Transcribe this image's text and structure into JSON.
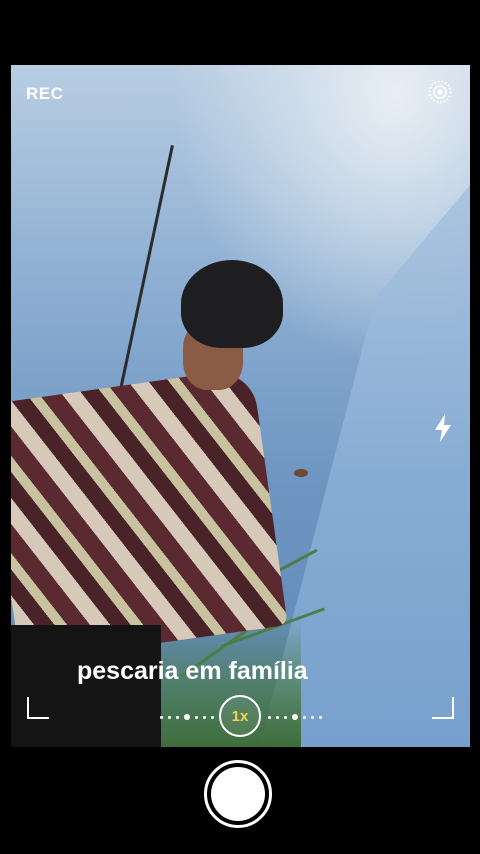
{
  "camera": {
    "rec_label": "REC",
    "caption": "pescaria em família",
    "zoom_label": "1x"
  },
  "icons": {
    "top_right": "target-icon",
    "flash": "flash-icon",
    "shutter": "shutter-button"
  },
  "colors": {
    "zoom_accent": "#f2d64a",
    "background": "#000000"
  }
}
